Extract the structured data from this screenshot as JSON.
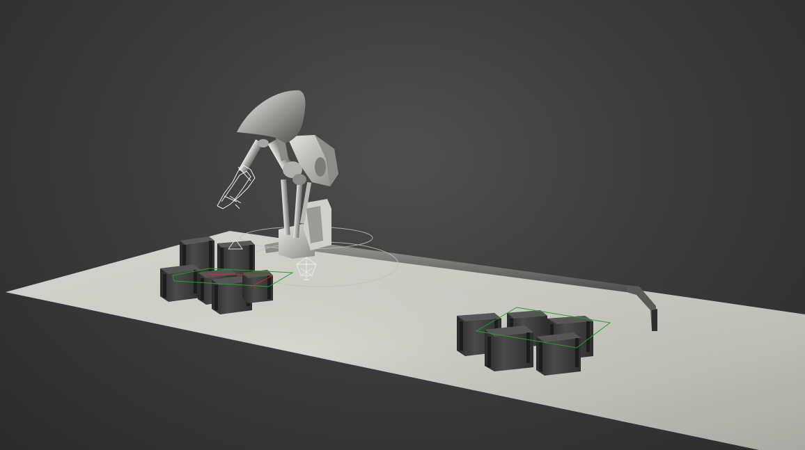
{
  "viewport": {
    "background_color": "#3c3c3c",
    "floor_color": "#c9c9c2",
    "object_color": "#3a3a3a",
    "robot_color": "#d8d8d4",
    "selection_color": "#1fa51f",
    "gizmo_color": "#bdbdbd"
  },
  "objects": {
    "robot": "robot-arm",
    "table": "floor-plane",
    "rail": "conveyor-rail",
    "left_group": "container-group-left",
    "right_group": "container-group-right"
  }
}
